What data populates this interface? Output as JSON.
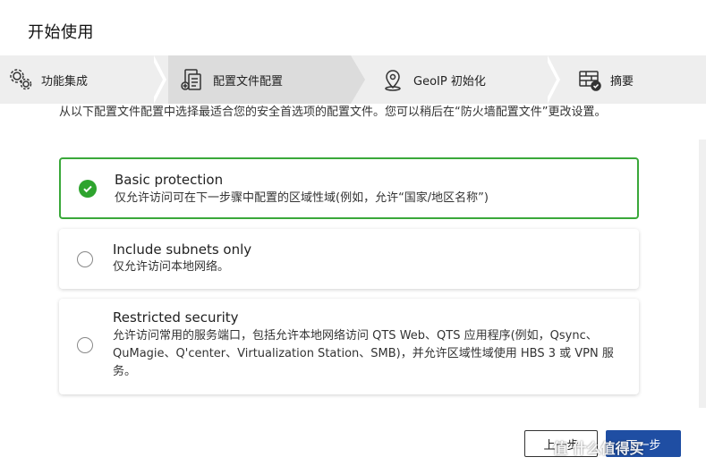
{
  "dialog": {
    "title": "开始使用"
  },
  "stepper": {
    "steps": [
      {
        "label": "功能集成",
        "icon": "gear-cluster-icon"
      },
      {
        "label": "配置文件配置",
        "icon": "document-add-icon",
        "active": true
      },
      {
        "label": "GeoIP 初始化",
        "icon": "location-pin-icon"
      },
      {
        "label": "摘要",
        "icon": "firewall-check-icon"
      }
    ]
  },
  "intro": {
    "text": "从以下配置文件配置中选择最适合您的安全首选项的配置文件。您可以稍后在“防火墙配置文件”更改设置。"
  },
  "options": [
    {
      "title": "Basic protection",
      "desc": "仅允许访问可在下一步骤中配置的区域性域(例如，允许“国家/地区名称”)",
      "selected": true
    },
    {
      "title": "Include subnets only",
      "desc": "仅允许访问本地网络。",
      "selected": false
    },
    {
      "title": "Restricted security",
      "desc": "允许访问常用的服务端口，包括允许本地网络访问 QTS Web、QTS 应用程序(例如，Qsync、QuMagie、Q'center、Virtualization Station、SMB)，并允许区域性域使用 HBS 3 或 VPN 服务。",
      "selected": false
    }
  ],
  "buttons": {
    "back": "上一步",
    "next": "下一步"
  },
  "watermark": "值 什么值得买",
  "colors": {
    "accent_green": "#2ea42e",
    "primary_blue": "#1f4ea3"
  }
}
